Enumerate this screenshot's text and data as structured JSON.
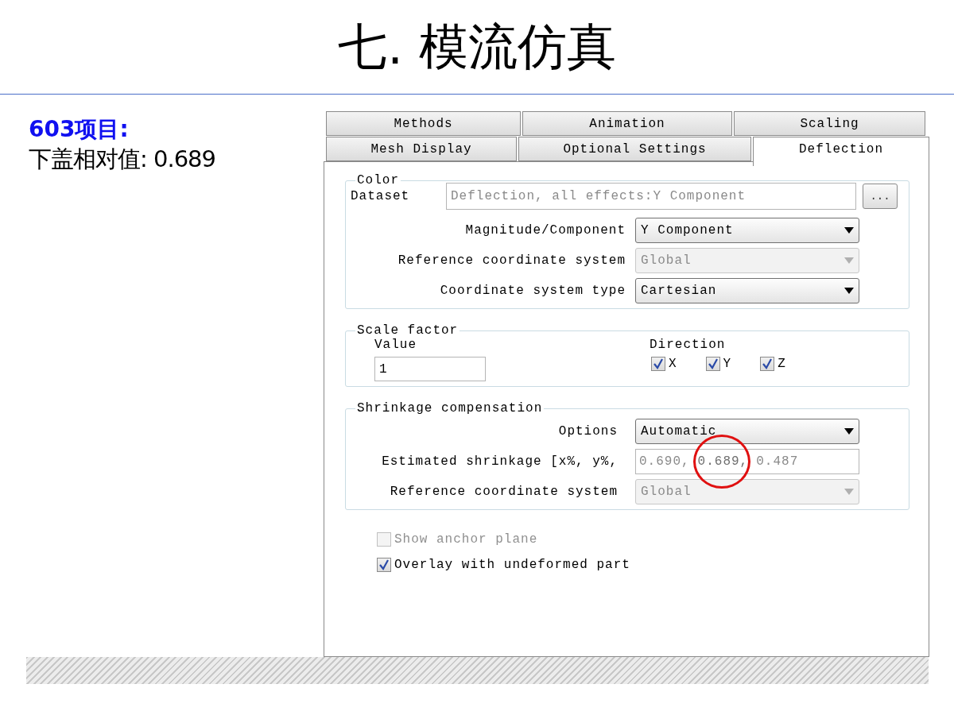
{
  "slide": {
    "title": "七. 模流仿真",
    "note_heading": "603项目:",
    "note_text": "下盖相对值: 0.689"
  },
  "tabs": [
    [
      {
        "label": "Methods",
        "selected": false
      },
      {
        "label": "Animation",
        "selected": false
      },
      {
        "label": "Scaling",
        "selected": false
      }
    ],
    [
      {
        "label": "Mesh Display",
        "selected": false
      },
      {
        "label": "Optional Settings",
        "selected": false
      },
      {
        "label": "Deflection",
        "selected": true
      }
    ]
  ],
  "color_group": {
    "title": "Color",
    "dataset_label": "Dataset",
    "dataset_value": "Deflection, all effects:Y Component",
    "browse_button": "...",
    "fields": [
      {
        "label": "Magnitude/Component",
        "value": "Y Component",
        "disabled": false
      },
      {
        "label": "Reference coordinate system",
        "value": "Global",
        "disabled": true
      },
      {
        "label": "Coordinate system type",
        "value": "Cartesian",
        "disabled": false
      }
    ]
  },
  "scale_factor": {
    "title": "Scale factor",
    "value_label": "Value",
    "value": "1",
    "direction_label": "Direction",
    "axes": [
      {
        "label": "X",
        "checked": true
      },
      {
        "label": "Y",
        "checked": true
      },
      {
        "label": "Z",
        "checked": true
      }
    ]
  },
  "shrinkage": {
    "title": "Shrinkage compensation",
    "options_label": "Options",
    "options_value": "Automatic",
    "estimated_label": "Estimated shrinkage [x%, y%,",
    "estimated_values": [
      {
        "text": "0.690,",
        "circled": false
      },
      {
        "text": "0.689,",
        "circled": true
      },
      {
        "text": "0.487",
        "circled": false
      }
    ],
    "reference_label": "Reference coordinate system",
    "reference_value": "Global",
    "reference_disabled": true
  },
  "checkboxes": [
    {
      "label": "Show anchor plane",
      "checked": false,
      "disabled": true
    },
    {
      "label": "Overlay with undeformed part",
      "checked": true,
      "disabled": false
    }
  ]
}
